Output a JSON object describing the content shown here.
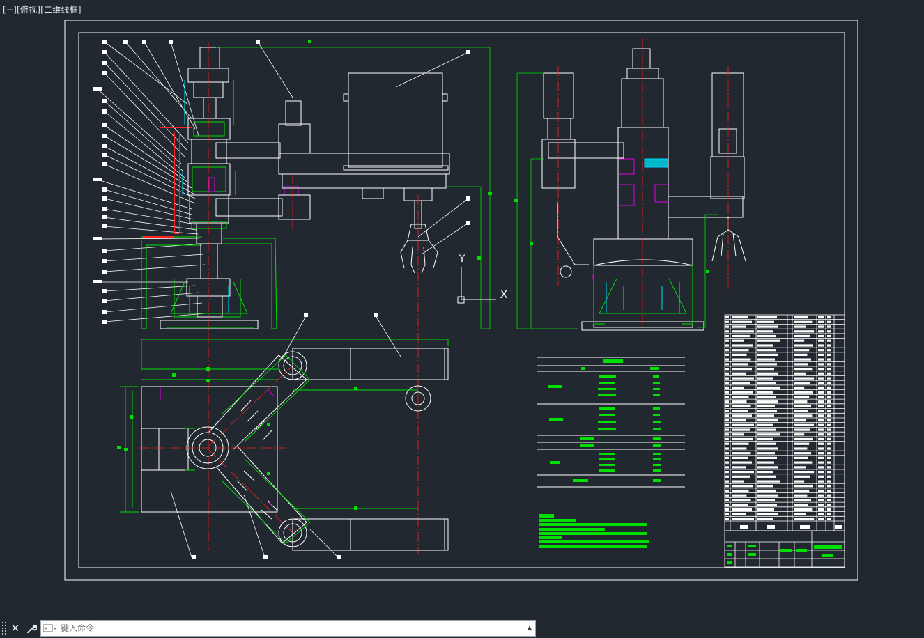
{
  "viewport": {
    "label": "[−][俯视][二维线框]"
  },
  "colors": {
    "background": "#212830",
    "lines": "#ffffff",
    "green": "#00e000",
    "red": "#ff2020",
    "cyan": "#00d8ff",
    "magenta": "#e000e0"
  },
  "ucs": {
    "y_label": "Y",
    "x_label": "X"
  },
  "command_bar": {
    "close_icon": "close-icon",
    "settings_icon": "wrench-icon",
    "placeholder": "键入命令"
  }
}
